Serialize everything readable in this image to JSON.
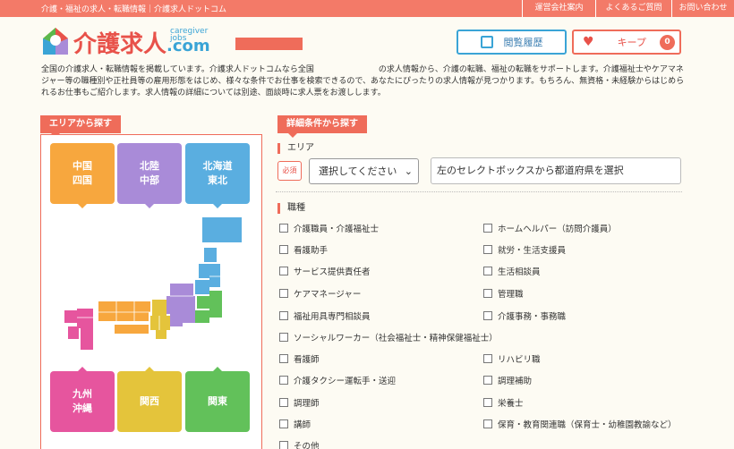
{
  "topbar": {
    "tagline": "介護・福祉の求人・転職情報｜介護求人ドットコム",
    "links": [
      "運営会社案内",
      "よくあるご質問",
      "お問い合わせ"
    ]
  },
  "logo": {
    "name": "介護求人",
    "sub1": "caregiver",
    "sub2": "jobs",
    "dotcom": ".com"
  },
  "header": {
    "history_label": "閲覧履歴",
    "keep_label": "キープ",
    "keep_count": "0"
  },
  "intro": "全国の介護求人・転職情報を掲載しています。介護求人ドットコムなら全国　　　　　　　　の求人情報から、介護の転職、福祉の転職をサポートします。介護福祉士やケアマネジャー等の職種別や正社員等の雇用形態をはじめ、様々な条件でお仕事を検索できるので、あなたにぴったりの求人情報が見つかります。もちろん、無資格・未経験からはじめられるお仕事もご紹介します。求人情報の詳細については別途、面談時に求人票をお渡しします。",
  "area": {
    "title": "エリアから探す",
    "tiles": {
      "chugoku": "中国\n四国",
      "hokuriku": "北陸\n中部",
      "hokkaido": "北海道\n東北",
      "kyushu": "九州\n沖縄",
      "kansai": "関西",
      "kanto": "関東"
    },
    "colors": {
      "chugoku": "#f7a73e",
      "hokuriku": "#a98bd8",
      "hokkaido": "#5aaee0",
      "kyushu": "#e6559e",
      "kansai": "#e4c43b",
      "kanto": "#62c15a"
    }
  },
  "detail": {
    "title": "詳細条件から探す",
    "area_label": "エリア",
    "required": "必須",
    "select_value": "選択してください",
    "select_hint": "左のセレクトボックスから都道府県を選択",
    "job_label": "職種",
    "jobs_left": [
      "介護職員・介護福祉士",
      "看護助手",
      "サービス提供責任者",
      "ケアマネージャー",
      "福祉用具専門相談員"
    ],
    "jobs_right": [
      "ホームヘルパー（訪問介護員）",
      "就労・生活支援員",
      "生活相談員",
      "管理職",
      "介護事務・事務職"
    ],
    "job_full": "ソーシャルワーカー（社会福祉士・精神保健福祉士）",
    "jobs_left2": [
      "看護師",
      "介護タクシー運転手・送迎",
      "調理師",
      "講師",
      "その他"
    ],
    "jobs_right2": [
      "リハビリ職",
      "調理補助",
      "栄養士",
      "保育・教育関連職（保育士・幼稚園教諭など）"
    ]
  }
}
